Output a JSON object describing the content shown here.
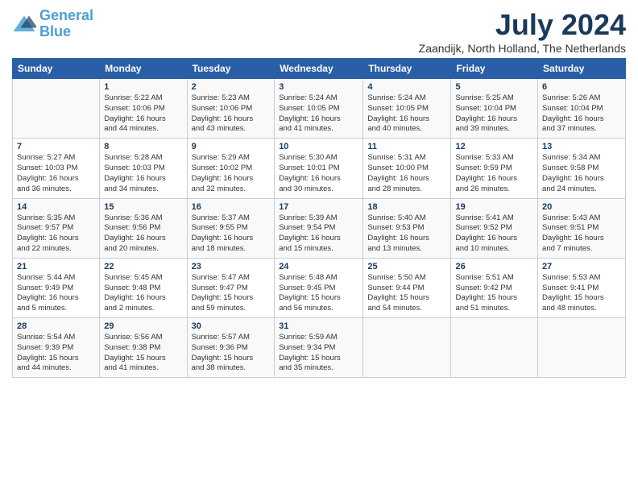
{
  "header": {
    "logo_line1": "General",
    "logo_line2": "Blue",
    "month": "July 2024",
    "location": "Zaandijk, North Holland, The Netherlands"
  },
  "weekdays": [
    "Sunday",
    "Monday",
    "Tuesday",
    "Wednesday",
    "Thursday",
    "Friday",
    "Saturday"
  ],
  "weeks": [
    [
      {
        "day": "",
        "info": ""
      },
      {
        "day": "1",
        "info": "Sunrise: 5:22 AM\nSunset: 10:06 PM\nDaylight: 16 hours\nand 44 minutes."
      },
      {
        "day": "2",
        "info": "Sunrise: 5:23 AM\nSunset: 10:06 PM\nDaylight: 16 hours\nand 43 minutes."
      },
      {
        "day": "3",
        "info": "Sunrise: 5:24 AM\nSunset: 10:05 PM\nDaylight: 16 hours\nand 41 minutes."
      },
      {
        "day": "4",
        "info": "Sunrise: 5:24 AM\nSunset: 10:05 PM\nDaylight: 16 hours\nand 40 minutes."
      },
      {
        "day": "5",
        "info": "Sunrise: 5:25 AM\nSunset: 10:04 PM\nDaylight: 16 hours\nand 39 minutes."
      },
      {
        "day": "6",
        "info": "Sunrise: 5:26 AM\nSunset: 10:04 PM\nDaylight: 16 hours\nand 37 minutes."
      }
    ],
    [
      {
        "day": "7",
        "info": "Sunrise: 5:27 AM\nSunset: 10:03 PM\nDaylight: 16 hours\nand 36 minutes."
      },
      {
        "day": "8",
        "info": "Sunrise: 5:28 AM\nSunset: 10:03 PM\nDaylight: 16 hours\nand 34 minutes."
      },
      {
        "day": "9",
        "info": "Sunrise: 5:29 AM\nSunset: 10:02 PM\nDaylight: 16 hours\nand 32 minutes."
      },
      {
        "day": "10",
        "info": "Sunrise: 5:30 AM\nSunset: 10:01 PM\nDaylight: 16 hours\nand 30 minutes."
      },
      {
        "day": "11",
        "info": "Sunrise: 5:31 AM\nSunset: 10:00 PM\nDaylight: 16 hours\nand 28 minutes."
      },
      {
        "day": "12",
        "info": "Sunrise: 5:33 AM\nSunset: 9:59 PM\nDaylight: 16 hours\nand 26 minutes."
      },
      {
        "day": "13",
        "info": "Sunrise: 5:34 AM\nSunset: 9:58 PM\nDaylight: 16 hours\nand 24 minutes."
      }
    ],
    [
      {
        "day": "14",
        "info": "Sunrise: 5:35 AM\nSunset: 9:57 PM\nDaylight: 16 hours\nand 22 minutes."
      },
      {
        "day": "15",
        "info": "Sunrise: 5:36 AM\nSunset: 9:56 PM\nDaylight: 16 hours\nand 20 minutes."
      },
      {
        "day": "16",
        "info": "Sunrise: 5:37 AM\nSunset: 9:55 PM\nDaylight: 16 hours\nand 18 minutes."
      },
      {
        "day": "17",
        "info": "Sunrise: 5:39 AM\nSunset: 9:54 PM\nDaylight: 16 hours\nand 15 minutes."
      },
      {
        "day": "18",
        "info": "Sunrise: 5:40 AM\nSunset: 9:53 PM\nDaylight: 16 hours\nand 13 minutes."
      },
      {
        "day": "19",
        "info": "Sunrise: 5:41 AM\nSunset: 9:52 PM\nDaylight: 16 hours\nand 10 minutes."
      },
      {
        "day": "20",
        "info": "Sunrise: 5:43 AM\nSunset: 9:51 PM\nDaylight: 16 hours\nand 7 minutes."
      }
    ],
    [
      {
        "day": "21",
        "info": "Sunrise: 5:44 AM\nSunset: 9:49 PM\nDaylight: 16 hours\nand 5 minutes."
      },
      {
        "day": "22",
        "info": "Sunrise: 5:45 AM\nSunset: 9:48 PM\nDaylight: 16 hours\nand 2 minutes."
      },
      {
        "day": "23",
        "info": "Sunrise: 5:47 AM\nSunset: 9:47 PM\nDaylight: 15 hours\nand 59 minutes."
      },
      {
        "day": "24",
        "info": "Sunrise: 5:48 AM\nSunset: 9:45 PM\nDaylight: 15 hours\nand 56 minutes."
      },
      {
        "day": "25",
        "info": "Sunrise: 5:50 AM\nSunset: 9:44 PM\nDaylight: 15 hours\nand 54 minutes."
      },
      {
        "day": "26",
        "info": "Sunrise: 5:51 AM\nSunset: 9:42 PM\nDaylight: 15 hours\nand 51 minutes."
      },
      {
        "day": "27",
        "info": "Sunrise: 5:53 AM\nSunset: 9:41 PM\nDaylight: 15 hours\nand 48 minutes."
      }
    ],
    [
      {
        "day": "28",
        "info": "Sunrise: 5:54 AM\nSunset: 9:39 PM\nDaylight: 15 hours\nand 44 minutes."
      },
      {
        "day": "29",
        "info": "Sunrise: 5:56 AM\nSunset: 9:38 PM\nDaylight: 15 hours\nand 41 minutes."
      },
      {
        "day": "30",
        "info": "Sunrise: 5:57 AM\nSunset: 9:36 PM\nDaylight: 15 hours\nand 38 minutes."
      },
      {
        "day": "31",
        "info": "Sunrise: 5:59 AM\nSunset: 9:34 PM\nDaylight: 15 hours\nand 35 minutes."
      },
      {
        "day": "",
        "info": ""
      },
      {
        "day": "",
        "info": ""
      },
      {
        "day": "",
        "info": ""
      }
    ]
  ]
}
